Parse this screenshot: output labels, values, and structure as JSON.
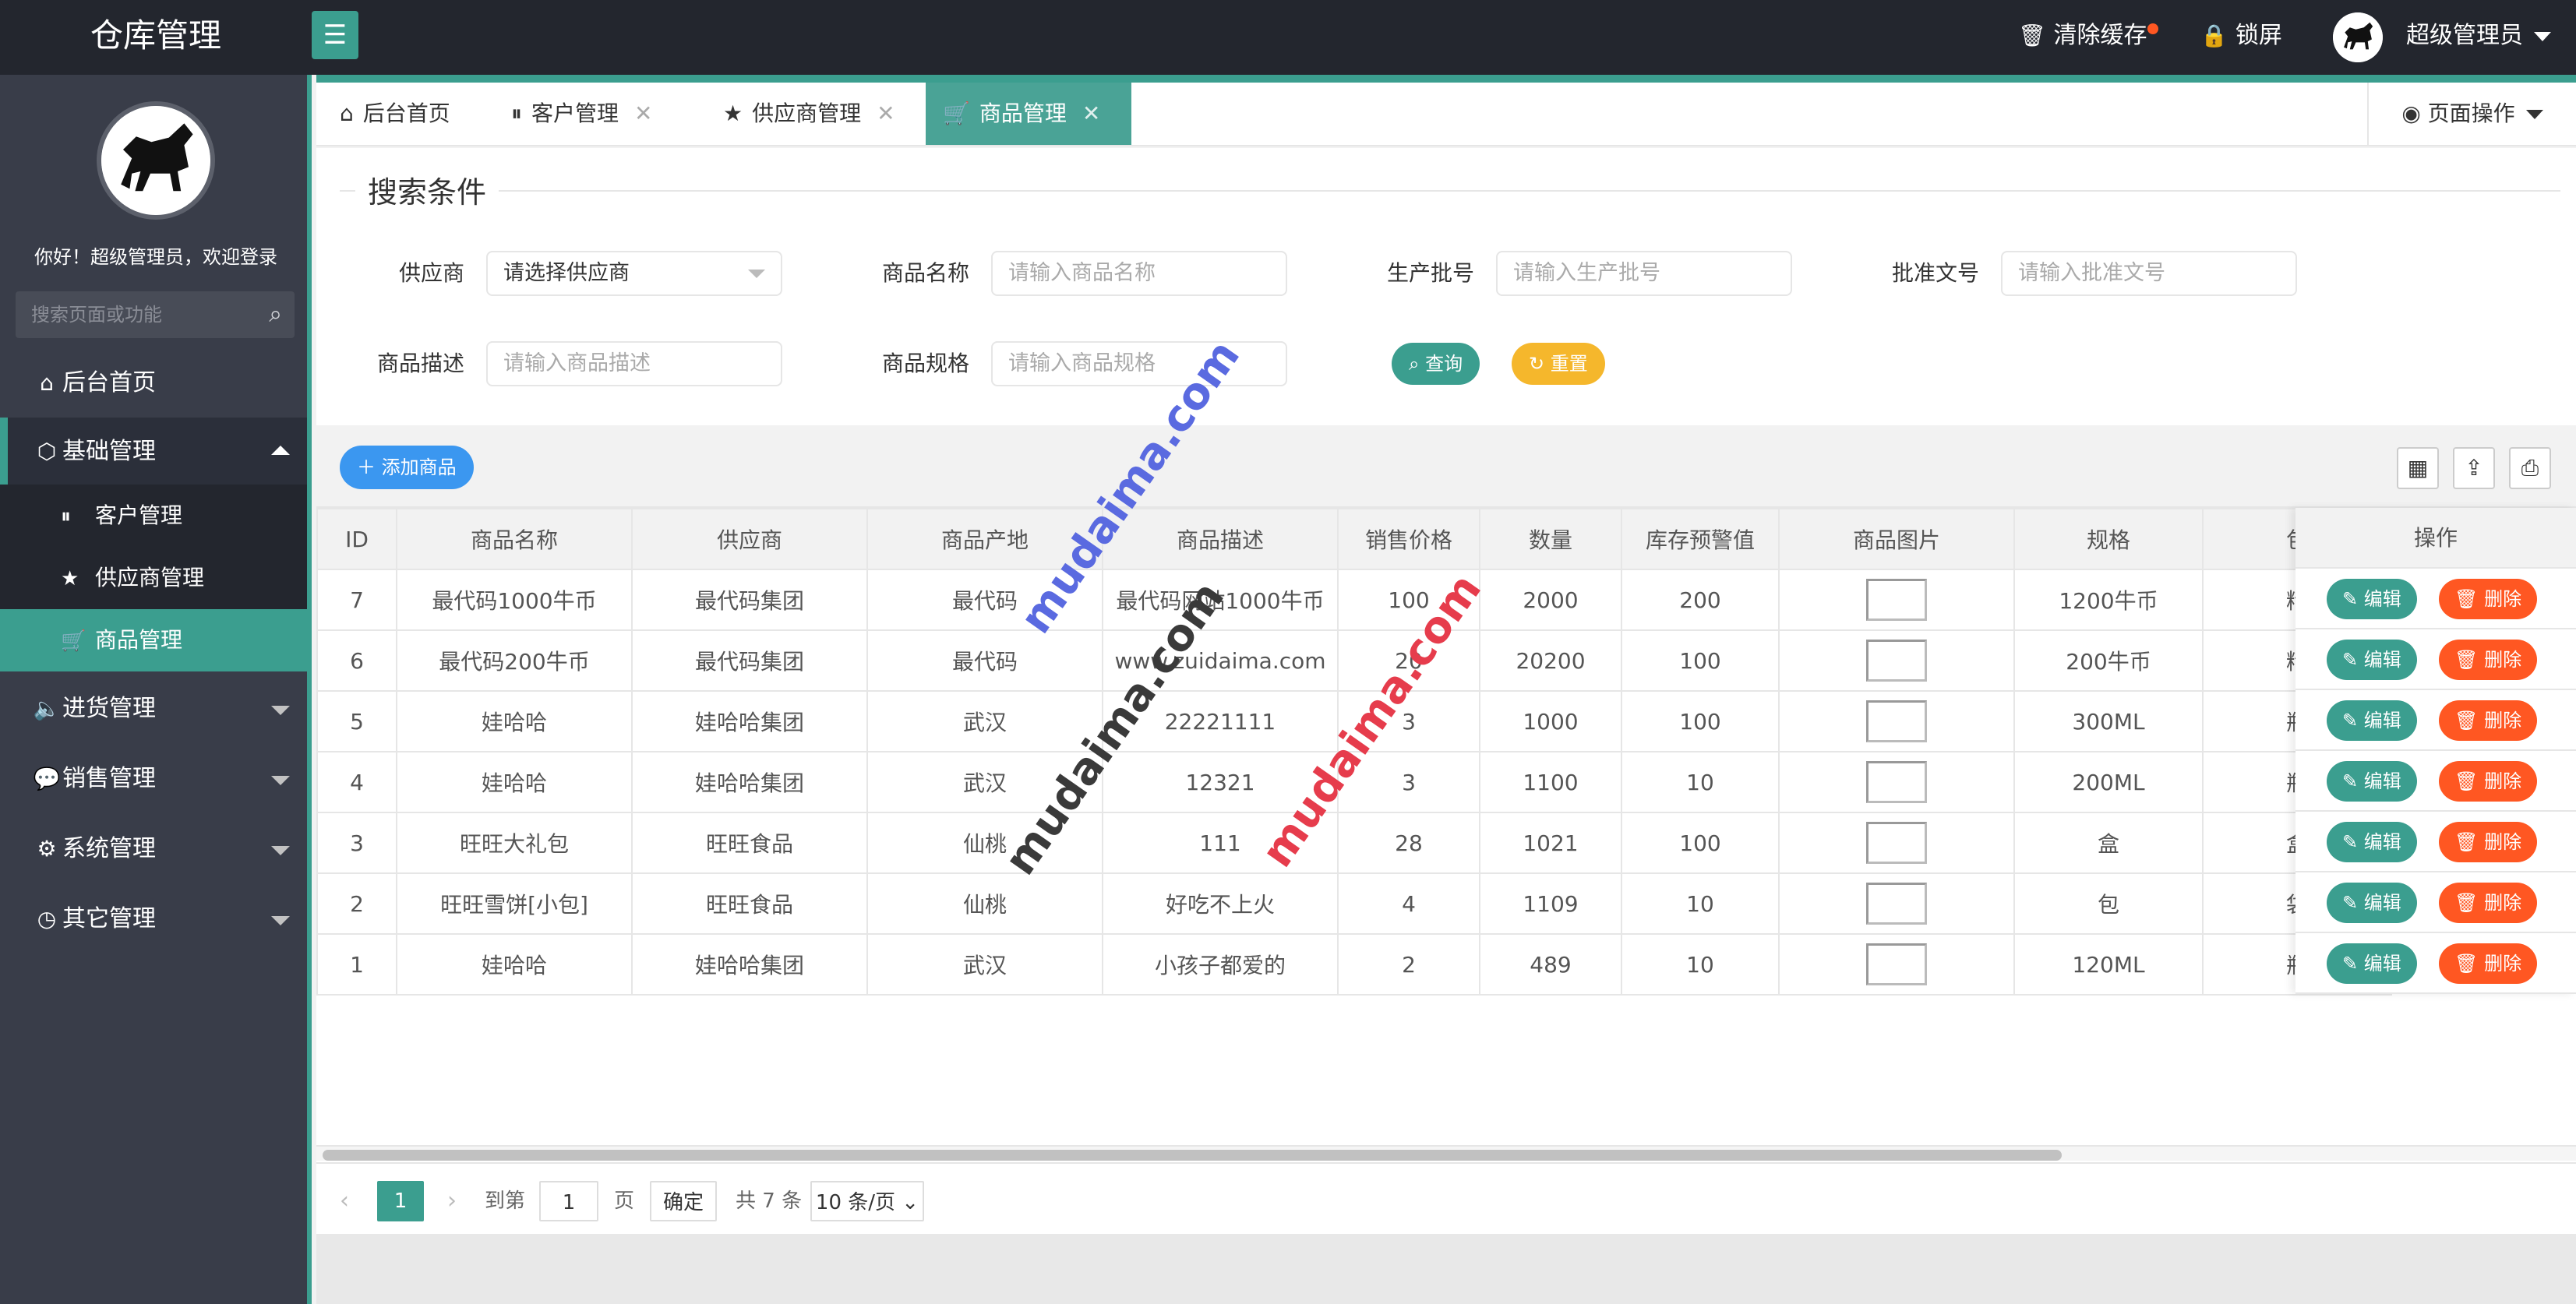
{
  "header": {
    "app_title": "仓库管理",
    "menu_icon": "hamburger-icon",
    "clear_cache": "清除缓存",
    "lock_screen": "锁屏",
    "user_name": "超级管理员"
  },
  "sidebar": {
    "welcome": "你好！超级管理员，欢迎登录",
    "search_placeholder": "搜索页面或功能",
    "items": [
      {
        "label": "后台首页",
        "icon": "home-icon"
      },
      {
        "label": "基础管理",
        "icon": "cube-icon"
      },
      {
        "label": "进货管理",
        "icon": "speaker-icon"
      },
      {
        "label": "销售管理",
        "icon": "chat-icon"
      },
      {
        "label": "系统管理",
        "icon": "gear-icon"
      },
      {
        "label": "其它管理",
        "icon": "clock-icon"
      }
    ],
    "sub_items": [
      {
        "label": "客户管理",
        "icon": "pause-icon"
      },
      {
        "label": "供应商管理",
        "icon": "star-icon"
      },
      {
        "label": "商品管理",
        "icon": "cart-icon"
      }
    ]
  },
  "tabs": [
    {
      "label": "后台首页",
      "icon": "home-icon"
    },
    {
      "label": "客户管理",
      "icon": "pause-icon"
    },
    {
      "label": "供应商管理",
      "icon": "star-icon"
    },
    {
      "label": "商品管理",
      "icon": "cart-icon"
    }
  ],
  "page_ops": "页面操作",
  "search": {
    "legend": "搜索条件",
    "supplier_label": "供应商",
    "supplier_value": "请选择供应商",
    "name_label": "商品名称",
    "name_placeholder": "请输入商品名称",
    "batch_label": "生产批号",
    "batch_placeholder": "请输入生产批号",
    "approval_label": "批准文号",
    "approval_placeholder": "请输入批准文号",
    "desc_label": "商品描述",
    "desc_placeholder": "请输入商品描述",
    "spec_label": "商品规格",
    "spec_placeholder": "请输入商品规格",
    "query_btn": "查询",
    "reset_btn": "重置"
  },
  "toolbar": {
    "add_btn": "添加商品"
  },
  "table": {
    "headers": [
      "ID",
      "商品名称",
      "供应商",
      "商品产地",
      "商品描述",
      "销售价格",
      "数量",
      "库存预警值",
      "商品图片",
      "规格",
      "包",
      "操作"
    ],
    "rows": [
      {
        "id": "7",
        "name": "最代码1000牛币",
        "supplier": "最代码集团",
        "origin": "最代码",
        "desc": "最代码网站1000牛币",
        "price": "100",
        "qty": "2000",
        "warn": "200",
        "spec": "1200牛币",
        "pack": "精"
      },
      {
        "id": "6",
        "name": "最代码200牛币",
        "supplier": "最代码集团",
        "origin": "最代码",
        "desc": "www.zuidaima.com",
        "price": "20",
        "qty": "20200",
        "warn": "100",
        "spec": "200牛币",
        "pack": "精"
      },
      {
        "id": "5",
        "name": "娃哈哈",
        "supplier": "娃哈哈集团",
        "origin": "武汉",
        "desc": "22221111",
        "price": "3",
        "qty": "1000",
        "warn": "100",
        "spec": "300ML",
        "pack": "瓶"
      },
      {
        "id": "4",
        "name": "娃哈哈",
        "supplier": "娃哈哈集团",
        "origin": "武汉",
        "desc": "12321",
        "price": "3",
        "qty": "1100",
        "warn": "10",
        "spec": "200ML",
        "pack": "瓶"
      },
      {
        "id": "3",
        "name": "旺旺大礼包",
        "supplier": "旺旺食品",
        "origin": "仙桃",
        "desc": "111",
        "price": "28",
        "qty": "1021",
        "warn": "100",
        "spec": "盒",
        "pack": "盒"
      },
      {
        "id": "2",
        "name": "旺旺雪饼[小包]",
        "supplier": "旺旺食品",
        "origin": "仙桃",
        "desc": "好吃不上火",
        "price": "4",
        "qty": "1109",
        "warn": "10",
        "spec": "包",
        "pack": "袋"
      },
      {
        "id": "1",
        "name": "娃哈哈",
        "supplier": "娃哈哈集团",
        "origin": "武汉",
        "desc": "小孩子都爱的",
        "price": "2",
        "qty": "489",
        "warn": "10",
        "spec": "120ML",
        "pack": "瓶"
      }
    ],
    "edit_label": "编辑",
    "delete_label": "删除"
  },
  "pager": {
    "current": "1",
    "goto_label": "到第",
    "goto_value": "1",
    "page_unit": "页",
    "confirm": "确定",
    "total": "共 7 条",
    "page_size": "10 条/页"
  },
  "watermarks": [
    "mudaima.com",
    "mudaima.com",
    "mudaima.com"
  ],
  "colors": {
    "accent": "#3b9e8f",
    "header": "#23262e",
    "sidebar": "#393d49",
    "danger": "#ff5722",
    "warning": "#f5b72c",
    "primary": "#3b97f0"
  }
}
